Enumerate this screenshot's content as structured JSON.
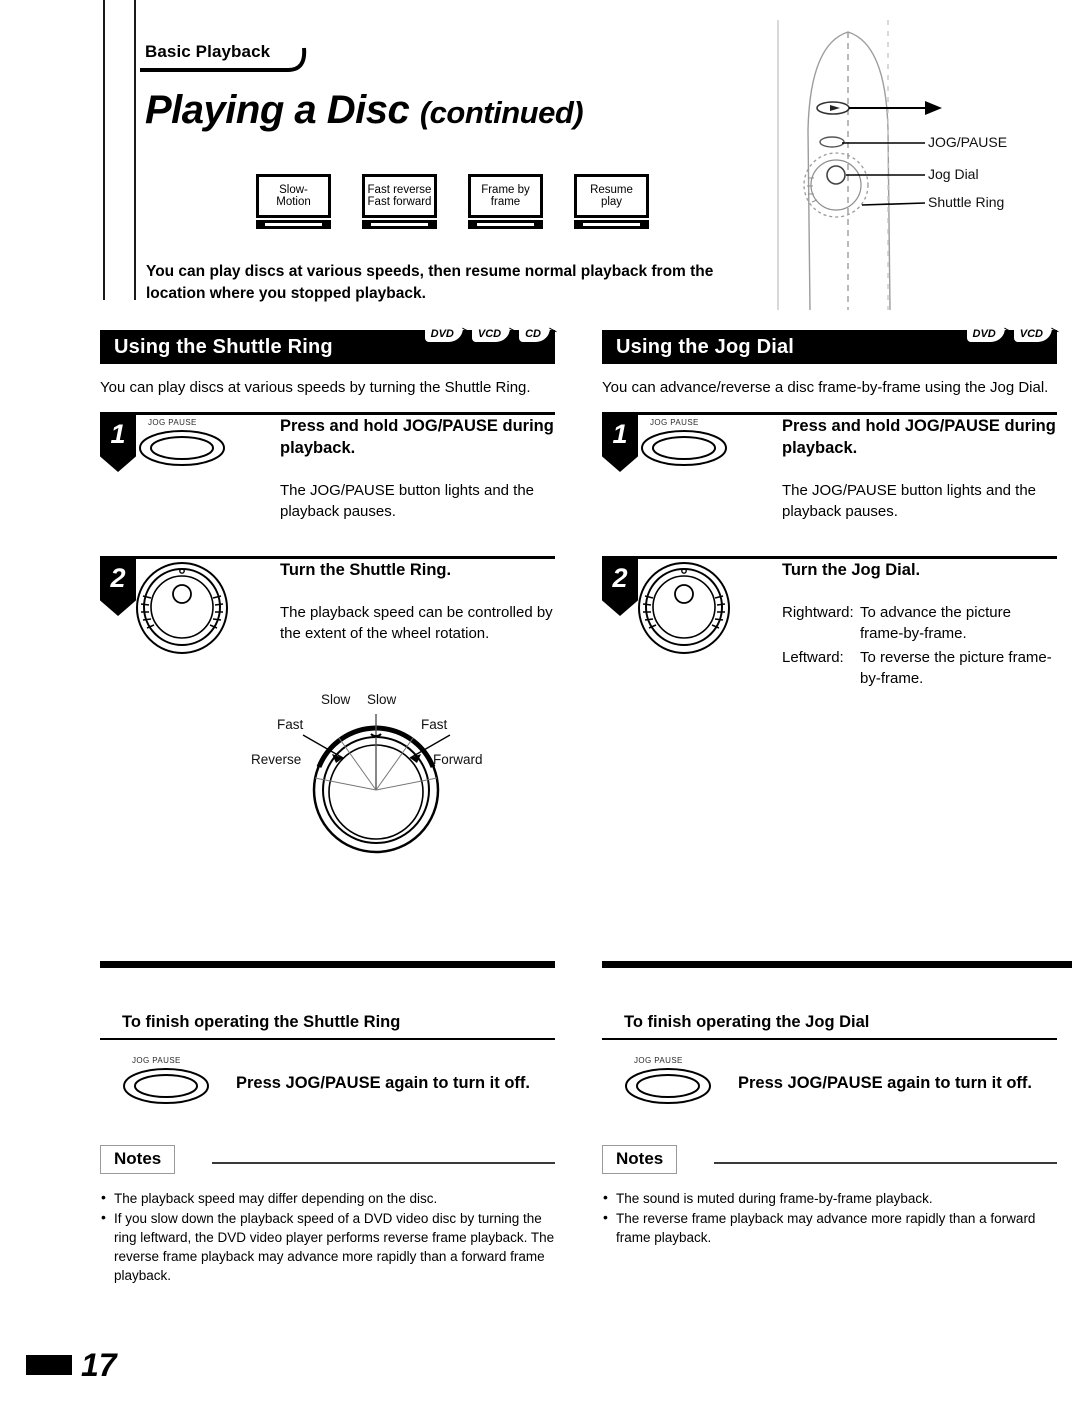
{
  "breadcrumb": "Basic Playback",
  "title": {
    "main": "Playing a Disc",
    "continued": "(continued)"
  },
  "features": [
    {
      "line1": "Slow-",
      "line2": "Motion"
    },
    {
      "line1": "Fast reverse",
      "line2": "Fast forward"
    },
    {
      "line1": "Frame by",
      "line2": "frame"
    },
    {
      "line1": "Resume",
      "line2": "play"
    }
  ],
  "intro": "You can play discs at various speeds, then resume normal playback from the location where you stopped playback.",
  "remote": {
    "labels": {
      "play": "",
      "jog_pause": "JOG/PAUSE",
      "jog_dial": "Jog Dial",
      "shuttle_ring": "Shuttle Ring"
    }
  },
  "left_column": {
    "section_title": "Using the Shuttle Ring",
    "badges": [
      "DVD",
      "VCD",
      "CD"
    ],
    "lead": "You can play discs at various speeds by turning the Shuttle Ring.",
    "steps": [
      {
        "number": "1",
        "button_label": "JOG PAUSE",
        "title": "Press and hold JOG/PAUSE during playback.",
        "description": "The JOG/PAUSE button lights and the playback pauses."
      },
      {
        "number": "2",
        "title": "Turn the Shuttle Ring.",
        "description": "The playback speed can be controlled by the extent of the wheel rotation."
      }
    ],
    "speed_diagram": {
      "slow_left": "Slow",
      "slow_right": "Slow",
      "fast_left": "Fast",
      "fast_right": "Fast",
      "reverse": "Reverse",
      "forward": "Forward"
    },
    "finish": {
      "title": "To finish operating the Shuttle Ring",
      "button_label": "JOG PAUSE",
      "text": "Press JOG/PAUSE again to turn it off."
    },
    "notes": {
      "heading": "Notes",
      "items": [
        "The playback speed may differ depending on the disc.",
        "If you slow down the playback speed of a DVD video disc by turning the ring leftward, the DVD video player performs reverse frame playback. The reverse frame playback may advance more rapidly than a forward frame playback."
      ]
    }
  },
  "right_column": {
    "section_title": "Using the Jog Dial",
    "badges": [
      "DVD",
      "VCD"
    ],
    "lead": "You can advance/reverse a disc frame-by-frame using the Jog Dial.",
    "steps": [
      {
        "number": "1",
        "button_label": "JOG PAUSE",
        "title": "Press and hold JOG/PAUSE during playback.",
        "description": "The JOG/PAUSE button lights and the playback pauses."
      },
      {
        "number": "2",
        "title": "Turn the Jog Dial.",
        "directions": [
          {
            "key": "Rightward:",
            "value": "To advance the picture frame-by-frame."
          },
          {
            "key": "Leftward:",
            "value": "To reverse the picture frame-by-frame."
          }
        ]
      }
    ],
    "finish": {
      "title": "To finish operating the Jog Dial",
      "button_label": "JOG PAUSE",
      "text": "Press JOG/PAUSE again to turn it off."
    },
    "notes": {
      "heading": "Notes",
      "items": [
        "The sound is muted during frame-by-frame playback.",
        "The reverse frame playback may advance more rapidly than a forward frame playback."
      ]
    }
  },
  "page_number": "17"
}
